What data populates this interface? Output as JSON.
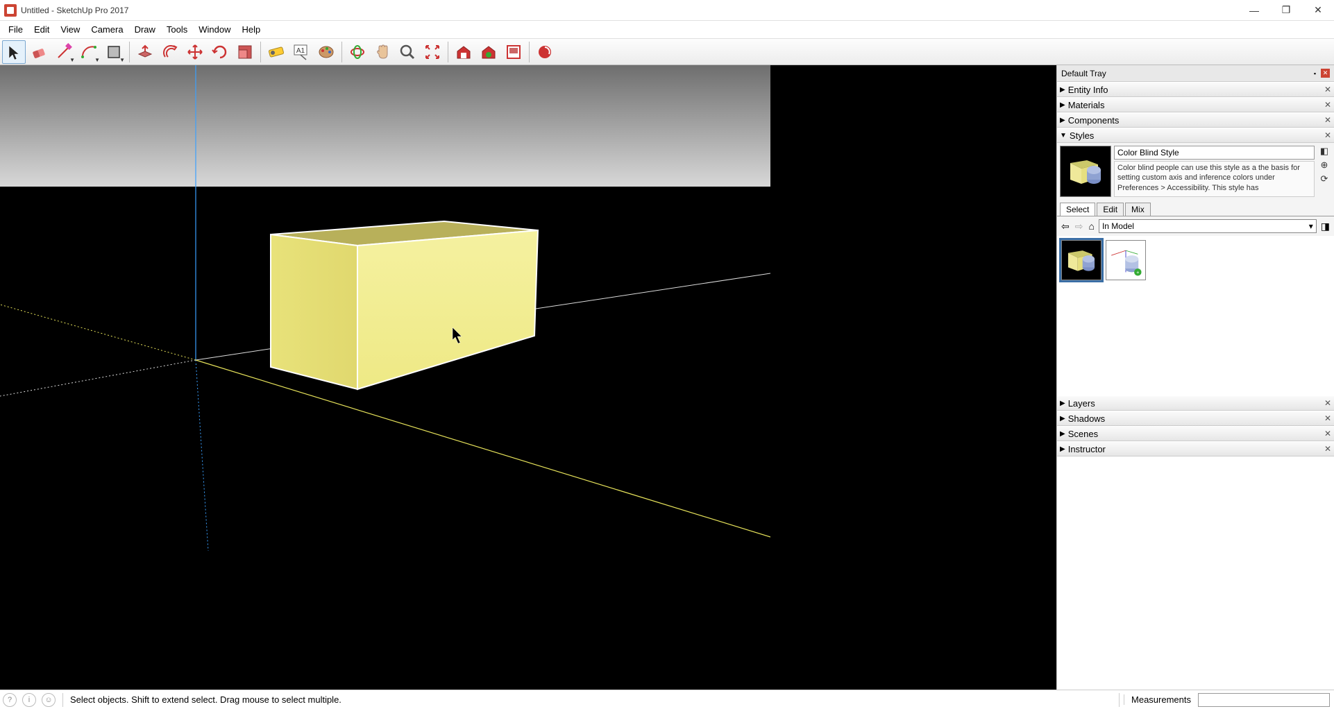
{
  "title": "Untitled - SketchUp Pro 2017",
  "menu": [
    "File",
    "Edit",
    "View",
    "Camera",
    "Draw",
    "Tools",
    "Window",
    "Help"
  ],
  "toolbar": [
    {
      "name": "select-tool",
      "active": true
    },
    {
      "name": "eraser-tool"
    },
    {
      "name": "line-tool",
      "drop": true
    },
    {
      "name": "arc-tool",
      "drop": true
    },
    {
      "name": "shape-tool",
      "drop": true
    },
    {
      "sep": true
    },
    {
      "name": "pushpull-tool"
    },
    {
      "name": "offset-tool"
    },
    {
      "name": "move-tool"
    },
    {
      "name": "rotate-tool"
    },
    {
      "name": "scale-tool"
    },
    {
      "sep": true
    },
    {
      "name": "measure-tool"
    },
    {
      "name": "text-tool"
    },
    {
      "name": "paint-tool"
    },
    {
      "sep": true
    },
    {
      "name": "orbit-tool"
    },
    {
      "name": "pan-tool"
    },
    {
      "name": "zoom-tool"
    },
    {
      "name": "zoomextents-tool"
    },
    {
      "sep": true
    },
    {
      "name": "warehouse-tool"
    },
    {
      "name": "ext-warehouse-tool"
    },
    {
      "name": "layout-tool"
    },
    {
      "sep": true
    },
    {
      "name": "ext-manager-tool"
    }
  ],
  "tray": {
    "title": "Default Tray",
    "panels_top": [
      {
        "label": "Entity Info",
        "open": false
      },
      {
        "label": "Materials",
        "open": false
      },
      {
        "label": "Components",
        "open": false
      },
      {
        "label": "Styles",
        "open": true
      }
    ],
    "panels_bottom": [
      {
        "label": "Layers",
        "open": false
      },
      {
        "label": "Shadows",
        "open": false
      },
      {
        "label": "Scenes",
        "open": false
      },
      {
        "label": "Instructor",
        "open": false
      }
    ]
  },
  "styles": {
    "name": "Color Blind Style",
    "description": "Color blind people can use this style as a the basis for setting custom axis and inference colors under Preferences > Accessibility.  This style has",
    "tabs": [
      "Select",
      "Edit",
      "Mix"
    ],
    "active_tab": 0,
    "nav_combo": "In Model"
  },
  "statusbar": {
    "message": "Select objects. Shift to extend select. Drag mouse to select multiple.",
    "measurements_label": "Measurements"
  }
}
